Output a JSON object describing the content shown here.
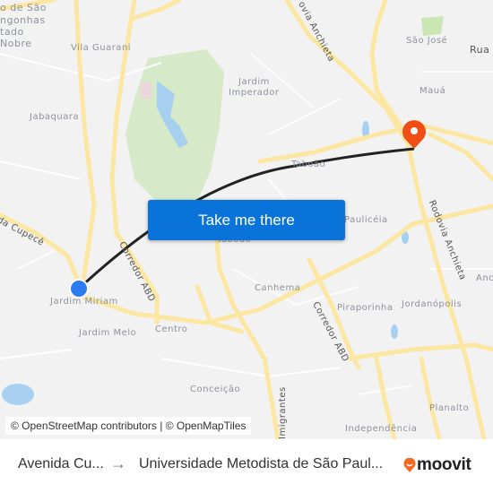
{
  "map": {
    "labels": {
      "sao_cong": "o de São",
      "congonhas": "ngonhas",
      "estado": "tado",
      "nobre": "Nobre",
      "vila_guarani": "Vila Guarani",
      "jabaquara": "Jabaquara",
      "jardim": "Jardim",
      "imperador": "Imperador",
      "rod_anchieta_top": "ovia Anchieta",
      "sao_jose": "São José",
      "rua": "Rua S",
      "maua": "Mauá",
      "taboao_top": "Taboão",
      "paulicea": "Paulicéia",
      "taboao": "Taboão",
      "cupece": "da Cupecê",
      "corredor_abd_1": "Corredor ABD",
      "jardim_miriam": "Jardim Miriam",
      "jardim_melo": "Jardim Melo",
      "centro": "Centro",
      "canhema": "Canhema",
      "corredor_abd_2": "Corredor ABD",
      "piraporinha": "Piraporinha",
      "jordanopolis": "Jordanópolis",
      "rod_anchieta": "Rodovia Anchieta",
      "anc": "Anc",
      "conceicao": "Conceição",
      "imigrantes": "Imigrantes",
      "planalto": "Planalto",
      "independencia": "Independência"
    },
    "origin_marker": {
      "name": "Avenida Cupecê",
      "color": "#2a7cf0"
    },
    "destination_marker": {
      "name": "Universidade Metodista de São Paulo",
      "color": "#f04e14"
    },
    "route_color": "#222222",
    "cta_label": "Take me there",
    "attribution": "© OpenStreetMap contributors | © OpenMapTiles"
  },
  "footer": {
    "from": "Avenida Cu...",
    "arrow": "→",
    "to": "Universidade Metodista de São Paul...",
    "brand": "moovit",
    "brand_color": "#f26a21"
  }
}
